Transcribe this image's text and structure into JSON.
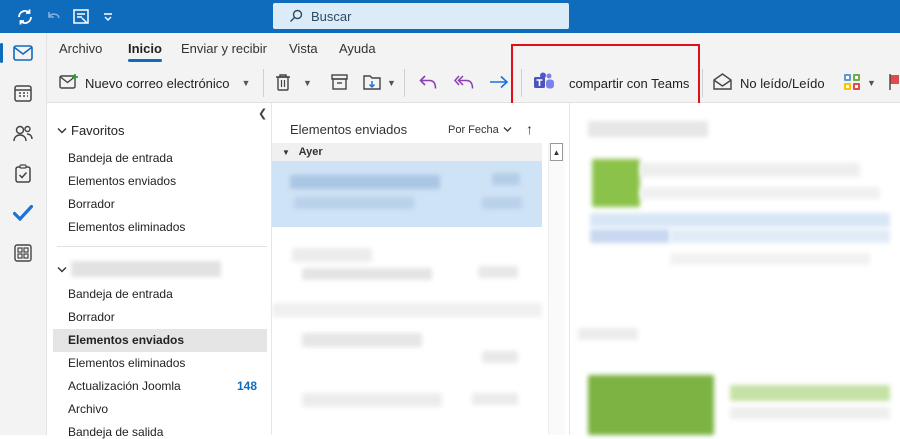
{
  "titlebar": {
    "search_placeholder": "Buscar",
    "icons": [
      "sync-icon",
      "undo-icon",
      "view-icon",
      "customize-icon"
    ]
  },
  "rail": {
    "items": [
      "mail-icon",
      "calendar-icon",
      "people-icon",
      "tasks-icon",
      "todo-check-icon",
      "apps-icon"
    ]
  },
  "tabs": [
    {
      "label": "Archivo"
    },
    {
      "label": "Inicio",
      "active": true
    },
    {
      "label": "Enviar y recibir"
    },
    {
      "label": "Vista"
    },
    {
      "label": "Ayuda"
    }
  ],
  "ribbon": {
    "new_mail_label": "Nuevo correo electrónico",
    "share_teams_label": "compartir con Teams",
    "read_unread_label": "No leído/Leído"
  },
  "folders": {
    "favorites_label": "Favoritos",
    "favorites": [
      "Bandeja de entrada",
      "Elementos enviados",
      "Borrador",
      "Elementos eliminados"
    ],
    "account_items": [
      {
        "label": "Bandeja de entrada"
      },
      {
        "label": "Borrador"
      },
      {
        "label": "Elementos enviados",
        "selected": true
      },
      {
        "label": "Elementos eliminados"
      },
      {
        "label": "Actualización Joomla",
        "count": "148"
      },
      {
        "label": "Archivo"
      },
      {
        "label": "Bandeja de salida"
      }
    ]
  },
  "list": {
    "title": "Elementos enviados",
    "sort_label": "Por Fecha",
    "day_header": "Ayer"
  },
  "colors": {
    "accent": "#0f6cbd",
    "highlight": "#e0101a",
    "selected_row": "#cfe3f6"
  }
}
